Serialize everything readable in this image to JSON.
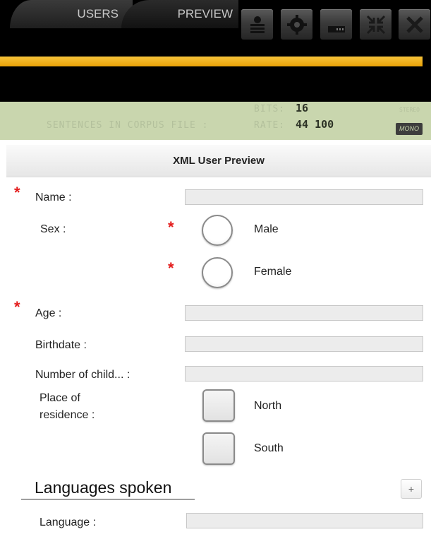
{
  "tabs": {
    "users": "USERS",
    "preview": "PREVIEW"
  },
  "toolbar": [
    {
      "icon": "users-stack-icon"
    },
    {
      "icon": "gear-icon"
    },
    {
      "icon": "window-minimize-icon"
    },
    {
      "icon": "collapse-arrows-icon"
    },
    {
      "icon": "close-icon"
    }
  ],
  "progress": {
    "value": 0.98,
    "color": "#f0b21c"
  },
  "lcd": {
    "sentences_label": "SENTENCES IN CORPUS FILE :",
    "bits_label": "BITS:",
    "bits_value": "16",
    "rate_label": "RATE:",
    "rate_value": "44 100",
    "stereo_label": "STEREO",
    "mono_label": "MONO"
  },
  "preview_title": "XML User Preview",
  "form": {
    "required_mark": "*",
    "name_label": "Name :",
    "sex_label": "Sex :",
    "sex_options": [
      "Male",
      "Female"
    ],
    "age_label": "Age :",
    "birthdate_label": "Birthdate :",
    "children_label": "Number of child... :",
    "residence_label_line1": "Place of",
    "residence_label_line2": "residence :",
    "residence_options": [
      "North",
      "South"
    ],
    "languages_title": "Languages spoken",
    "add_label": "+",
    "language_label": "Language :"
  },
  "colors": {
    "required": "#e31c1c",
    "lcd_bg": "#c9d6ae",
    "accent": "#f0b21c"
  }
}
